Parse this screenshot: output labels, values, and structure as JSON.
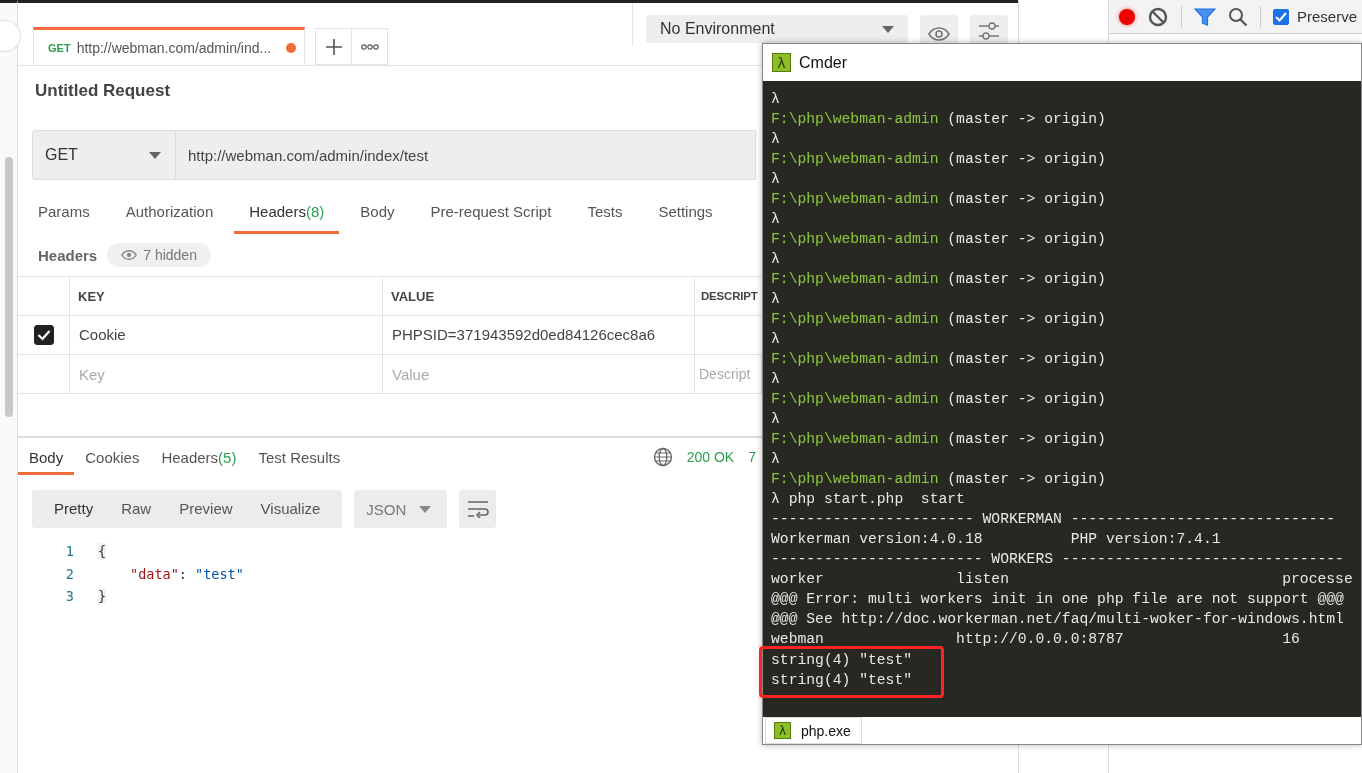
{
  "postman": {
    "tabs": [
      {
        "method": "GET",
        "title": "http://webman.com/admin/ind...",
        "unsaved": true,
        "selected": true
      }
    ],
    "environment": "No Environment",
    "request_name": "Untitled Request",
    "method": "GET",
    "url": "http://webman.com/admin/index/test",
    "request_tabs": [
      {
        "label": "Params",
        "selected": false
      },
      {
        "label": "Authorization",
        "selected": false
      },
      {
        "label": "Headers",
        "count": "(8)",
        "selected": true
      },
      {
        "label": "Body",
        "selected": false
      },
      {
        "label": "Pre-request Script",
        "selected": false
      },
      {
        "label": "Tests",
        "selected": false
      },
      {
        "label": "Settings",
        "selected": false
      }
    ],
    "headers": {
      "title": "Headers",
      "hidden": "7 hidden"
    },
    "table": {
      "columns": [
        "KEY",
        "VALUE",
        "DESCRIPT"
      ],
      "rows": [
        {
          "checked": true,
          "key": "Cookie",
          "value": "PHPSID=371943592d0ed84126cec8a6"
        }
      ],
      "empty_row": [
        {
          "placeholder": "Key"
        },
        {
          "placeholder": "Value"
        },
        {
          "placeholder": "Descript"
        }
      ]
    },
    "response": {
      "tabs": [
        {
          "label": "Body",
          "selected": true
        },
        {
          "label": "Cookies",
          "selected": false
        },
        {
          "label": "Headers",
          "count": "(5)",
          "selected": false
        },
        {
          "label": "Test Results",
          "selected": false
        }
      ],
      "status": "200 OK",
      "time": "7",
      "view_modes": [
        {
          "label": "Pretty",
          "selected": true
        },
        {
          "label": "Raw",
          "selected": false
        },
        {
          "label": "Preview",
          "selected": false
        },
        {
          "label": "Visualize",
          "selected": false
        }
      ],
      "format": "JSON",
      "lines": [
        {
          "number": "1",
          "text": "{"
        },
        {
          "number": "2",
          "key": "\"data\"",
          "sep": ": ",
          "value": "\"test\""
        },
        {
          "number": "3",
          "text": "}"
        }
      ]
    }
  },
  "devtools": {
    "recording": true,
    "preserve": {
      "label": "Preserve",
      "checked": true
    }
  },
  "cmder": {
    "logo": "λ",
    "title": "Cmder",
    "lines": [
      {
        "kind": "lambda",
        "text": "λ"
      },
      {
        "kind": "prompt",
        "path": "F:\\php\\webman-admin",
        "branch": "(master -> origin)"
      },
      {
        "kind": "lambda",
        "text": "λ"
      },
      {
        "kind": "prompt",
        "path": "F:\\php\\webman-admin",
        "branch": "(master -> origin)"
      },
      {
        "kind": "lambda",
        "text": "λ"
      },
      {
        "kind": "prompt",
        "path": "F:\\php\\webman-admin",
        "branch": "(master -> origin)"
      },
      {
        "kind": "lambda",
        "text": "λ"
      },
      {
        "kind": "prompt",
        "path": "F:\\php\\webman-admin",
        "branch": "(master -> origin)"
      },
      {
        "kind": "lambda",
        "text": "λ"
      },
      {
        "kind": "prompt",
        "path": "F:\\php\\webman-admin",
        "branch": "(master -> origin)"
      },
      {
        "kind": "lambda",
        "text": "λ"
      },
      {
        "kind": "prompt",
        "path": "F:\\php\\webman-admin",
        "branch": "(master -> origin)"
      },
      {
        "kind": "lambda",
        "text": "λ"
      },
      {
        "kind": "prompt",
        "path": "F:\\php\\webman-admin",
        "branch": "(master -> origin)"
      },
      {
        "kind": "lambda",
        "text": "λ"
      },
      {
        "kind": "prompt",
        "path": "F:\\php\\webman-admin",
        "branch": "(master -> origin)"
      },
      {
        "kind": "lambda",
        "text": "λ"
      },
      {
        "kind": "prompt",
        "path": "F:\\php\\webman-admin",
        "branch": "(master -> origin)"
      },
      {
        "kind": "lambda",
        "text": "λ"
      },
      {
        "kind": "prompt",
        "path": "F:\\php\\webman-admin",
        "branch": "(master -> origin)"
      },
      {
        "kind": "text",
        "text": "λ php start.php  start"
      },
      {
        "kind": "text",
        "text": "----------------------- WORKERMAN ------------------------------"
      },
      {
        "kind": "text",
        "text": "Workerman version:4.0.18          PHP version:7.4.1"
      },
      {
        "kind": "text",
        "text": "------------------------ WORKERS --------------------------------"
      },
      {
        "kind": "text",
        "text": "worker               listen                               processe"
      },
      {
        "kind": "text",
        "text": "@@@ Error: multi workers init in one php file are not support @@@"
      },
      {
        "kind": "text",
        "text": "@@@ See http://doc.workerman.net/faq/multi-woker-for-windows.html"
      },
      {
        "kind": "text",
        "text": "webman               http://0.0.0.0:8787                  16"
      }
    ],
    "highlighted_lines": [
      "string(4) \"test\"",
      "string(4) \"test\""
    ],
    "tab": {
      "logo": "λ",
      "label": "php.exe"
    }
  }
}
